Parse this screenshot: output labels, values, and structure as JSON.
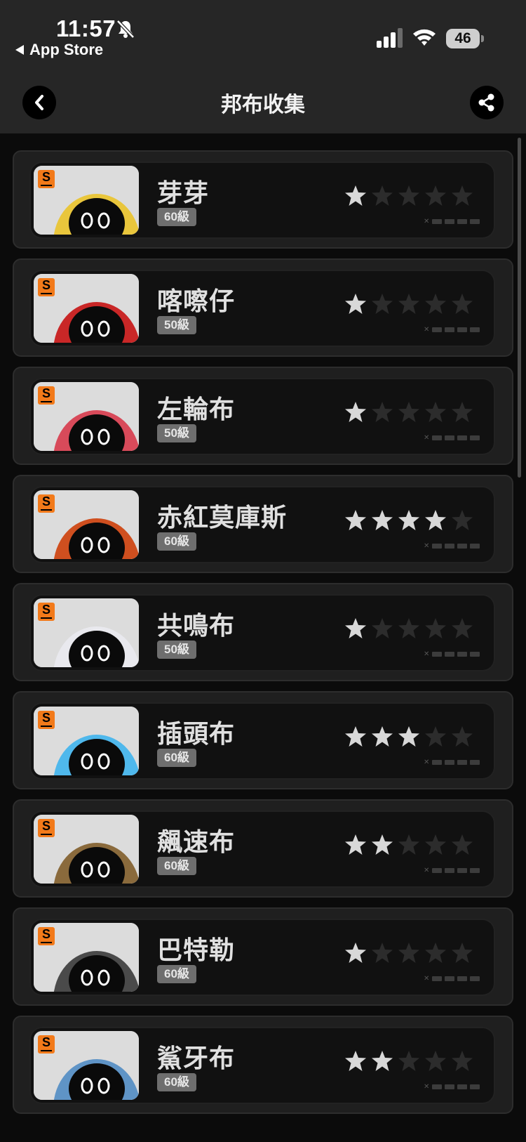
{
  "status_bar": {
    "time": "11:57",
    "back_app": "App Store",
    "battery": "46"
  },
  "nav": {
    "title": "邦布收集"
  },
  "items": [
    {
      "name": "芽芽",
      "level": "60級",
      "rank": "S",
      "stars": 1,
      "theme": "#e9c63c"
    },
    {
      "name": "喀嚓仔",
      "level": "50級",
      "rank": "S",
      "stars": 1,
      "theme": "#c92727"
    },
    {
      "name": "左輪布",
      "level": "50級",
      "rank": "S",
      "stars": 1,
      "theme": "#d84a5a"
    },
    {
      "name": "赤紅莫庫斯",
      "level": "60級",
      "rank": "S",
      "stars": 4,
      "theme": "#cf4f1f"
    },
    {
      "name": "共鳴布",
      "level": "50級",
      "rank": "S",
      "stars": 1,
      "theme": "#e9e9ee"
    },
    {
      "name": "插頭布",
      "level": "60級",
      "rank": "S",
      "stars": 3,
      "theme": "#4fb8ec"
    },
    {
      "name": "飆速布",
      "level": "60級",
      "rank": "S",
      "stars": 2,
      "theme": "#8a6a3c"
    },
    {
      "name": "巴特勒",
      "level": "60級",
      "rank": "S",
      "stars": 1,
      "theme": "#4a4a4a"
    },
    {
      "name": "鯊牙布",
      "level": "60級",
      "rank": "S",
      "stars": 2,
      "theme": "#5f94c6"
    }
  ],
  "colors": {
    "star_on": "#d8d8d8",
    "star_off": "#2c2c2c",
    "rank_badge": "#f27a1a"
  }
}
